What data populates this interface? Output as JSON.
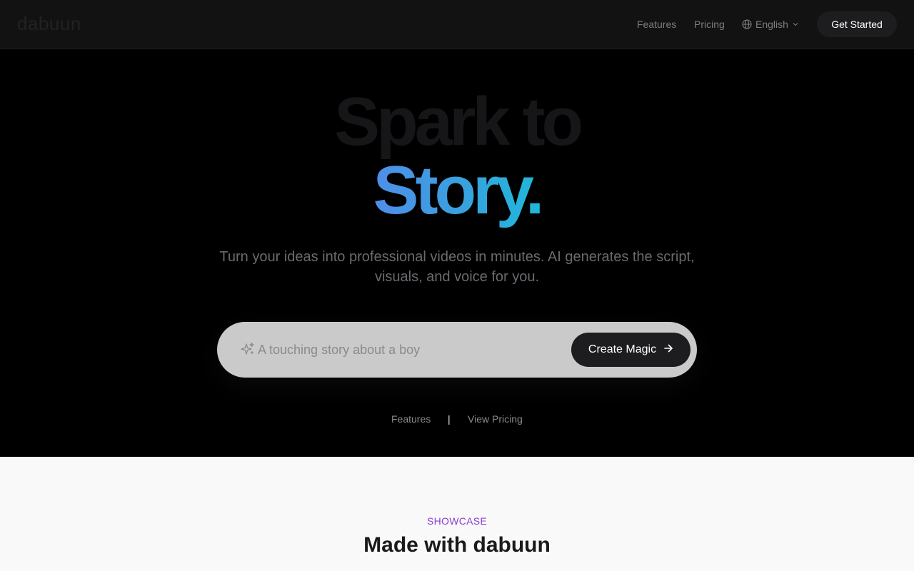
{
  "header": {
    "logo": "dabuun",
    "nav": {
      "features": "Features",
      "pricing": "Pricing"
    },
    "language": "English",
    "cta": "Get Started"
  },
  "hero": {
    "title_line1": "Spark to",
    "title_line2": "Story.",
    "subtitle": "Turn your ideas into professional videos in minutes. AI generates the script, visuals, and voice for you.",
    "prompt": {
      "placeholder": "A touching story about a boy",
      "value": ""
    },
    "create_button": "Create Magic",
    "links": {
      "features": "Features",
      "separator": "|",
      "pricing": "View Pricing"
    }
  },
  "showcase": {
    "eyebrow": "SHOWCASE",
    "title": "Made with dabuun"
  },
  "colors": {
    "accent_gradient_start": "#4f8ee8",
    "accent_gradient_end": "#1fb8d8",
    "eyebrow": "#8a3fd1",
    "button_dark": "#1d1d1f"
  },
  "icons": {
    "language": "globe-icon",
    "dropdown": "chevron-down-icon",
    "prompt": "sparkles-icon",
    "create": "arrow-right-icon"
  }
}
